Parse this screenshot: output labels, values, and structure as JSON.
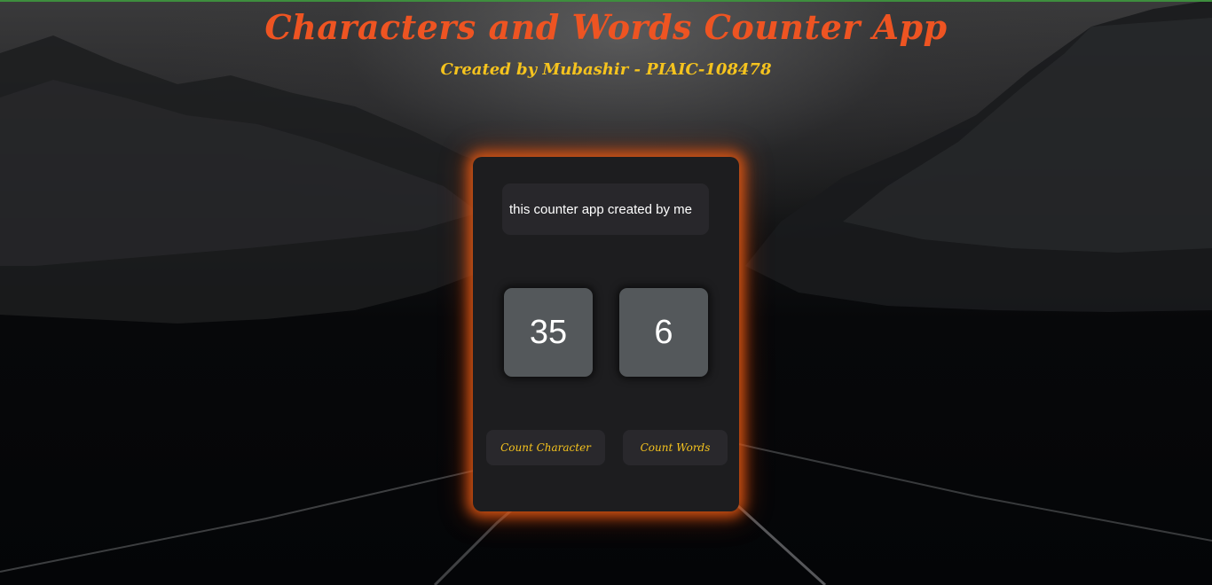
{
  "header": {
    "title": "Characters and Words Counter App",
    "subtitle": "Created by Mubashir - PIAIC-108478"
  },
  "input": {
    "value": "this counter app created by me"
  },
  "counters": {
    "characters": "35",
    "words": "6"
  },
  "buttons": {
    "count_character": "Count Character",
    "count_words": "Count Words"
  },
  "colors": {
    "title": "#ee5422",
    "subtitle": "#f5c31e",
    "card_glow": "#e65a14",
    "card_bg": "#1d1d1f",
    "counter_bg": "#54585b"
  }
}
